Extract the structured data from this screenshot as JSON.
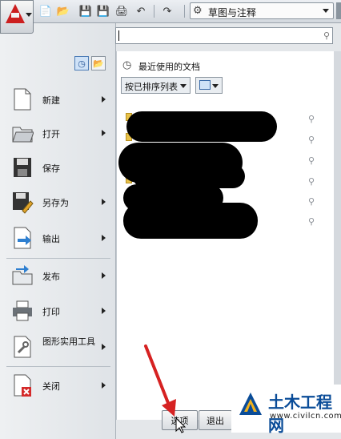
{
  "quick_access": {
    "icons": [
      "new-icon",
      "open-icon",
      "save-icon",
      "save-as-icon",
      "print-icon",
      "undo-icon",
      "redo-icon"
    ]
  },
  "workspace": {
    "label": "草图与注释"
  },
  "search": {
    "placeholder": ""
  },
  "menu": {
    "items": [
      {
        "label": "新建",
        "has_submenu": true
      },
      {
        "label": "打开",
        "has_submenu": true
      },
      {
        "label": "保存",
        "has_submenu": false
      },
      {
        "label": "另存为",
        "has_submenu": true
      },
      {
        "label": "输出",
        "has_submenu": true
      },
      {
        "label": "发布",
        "has_submenu": true
      },
      {
        "label": "打印",
        "has_submenu": true
      },
      {
        "label": "图形实用工具",
        "has_submenu": true
      },
      {
        "label": "关闭",
        "has_submenu": true
      }
    ]
  },
  "recent": {
    "title": "最近使用的文档",
    "sort_label": "按已排序列表",
    "pins": 6
  },
  "buttons": {
    "options": "选项",
    "exit": "退出"
  },
  "watermark": {
    "title": "土木工程网",
    "url": "www.civilcn.com"
  },
  "colors": {
    "accent_red": "#cc1f1f",
    "annotation_arrow": "#d62222",
    "watermark_blue": "#0a4c98"
  }
}
